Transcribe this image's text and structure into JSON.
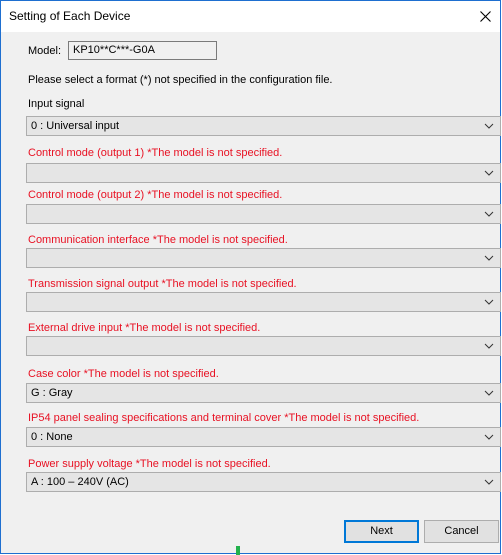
{
  "window": {
    "title": "Setting of Each Device"
  },
  "model": {
    "label": "Model:",
    "value": "KP10**C***-G0A"
  },
  "instruction": "Please select a format (*) not specified in the configuration file.",
  "fields": [
    {
      "label": "Input signal",
      "value": "0 : Universal input",
      "warning": false
    },
    {
      "label": "Control mode (output 1) *The model is not specified.",
      "value": "",
      "warning": true
    },
    {
      "label": "Control mode (output 2) *The model is not specified.",
      "value": "",
      "warning": true
    },
    {
      "label": "Communication interface *The model is not specified.",
      "value": "",
      "warning": true
    },
    {
      "label": "Transmission signal output *The model is not specified.",
      "value": "",
      "warning": true
    },
    {
      "label": "External drive input *The model is not specified.",
      "value": "",
      "warning": true
    },
    {
      "label": "Case color *The model is not specified.",
      "value": "G : Gray",
      "warning": true
    },
    {
      "label": "IP54 panel sealing specifications and terminal cover *The model is not specified.",
      "value": "0 : None",
      "warning": true
    },
    {
      "label": "Power supply voltage *The model is not specified.",
      "value": "A : 100 – 240V (AC)",
      "warning": true
    }
  ],
  "buttons": {
    "next": "Next",
    "cancel": "Cancel"
  },
  "colors": {
    "warning_text": "#e81123",
    "window_border": "#1e6fd0",
    "default_button_border": "#0078d7"
  },
  "icons": {
    "close": "close-icon",
    "dropdown": "chevron-down-icon"
  }
}
